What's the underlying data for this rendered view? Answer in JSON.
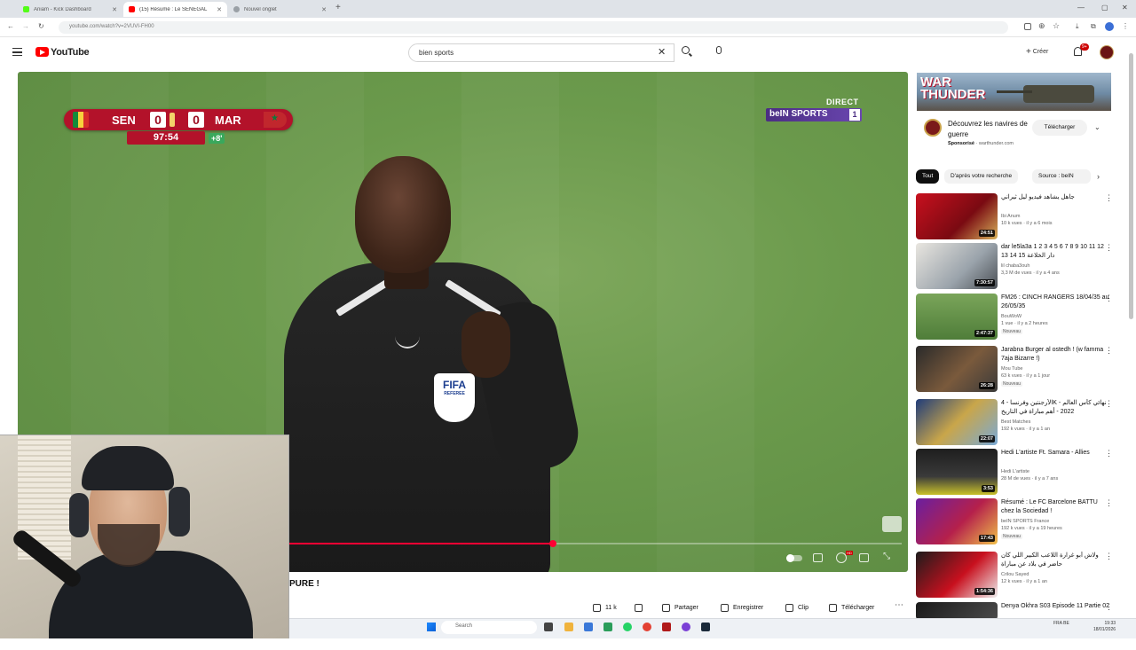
{
  "browser": {
    "tabs": [
      {
        "label": "Aniam - Kick Dashboard",
        "active": false,
        "fav_color": "#53fc18"
      },
      {
        "label": "(15) Résumé : Le SENEGAL",
        "active": true,
        "fav_color": "#ff0000"
      },
      {
        "label": "Nouvel onglet",
        "active": false,
        "fav_color": "#9aa0a6"
      }
    ],
    "url": "youtube.com/watch?v=2VUVI-FH00"
  },
  "header": {
    "logo_text": "YouTube",
    "search_value": "bien sports",
    "create_label": "Créer",
    "notif_count": "9+"
  },
  "video": {
    "scorebug": {
      "home": "SEN",
      "away": "MAR",
      "home_score": "0",
      "away_score": "0",
      "clock": "97:54",
      "added_time": "+8'"
    },
    "live_label": "DIRECT",
    "channel_bug": "beIN SPORTS",
    "channel_number": "1",
    "badge_text": "FIFA",
    "badge_sub": "REFEREE",
    "progress": 0.43,
    "title_fragment": "PURE !"
  },
  "actions": {
    "likes": "11 k",
    "share": "Partager",
    "save": "Enregistrer",
    "clip": "Clip",
    "download": "Télécharger"
  },
  "sidebar": {
    "ad": {
      "banner_title_1": "WAR",
      "banner_title_2": "THUNDER",
      "title": "Découvrez les navires de guerre",
      "sponsor_label": "Sponsorisé",
      "sponsor_site": "warthunder.com",
      "cta": "Télécharger"
    },
    "chips": [
      "Tout",
      "D'après votre recherche",
      "Source : beIN"
    ],
    "recommendations": [
      {
        "title": "جاهل يشاهد فيديو ليل ثيراني",
        "channel": "Ibi Anum",
        "meta": "10 k vues · il y a 6 mois",
        "badge": "",
        "duration": "24:51"
      },
      {
        "title": "dar le5la3a 1 2 3 4 5 6 7 8 9 10 11 12 13 14 15 دار الخلاعة",
        "channel": "lil chaba3ouh",
        "meta": "3,3 M de vues · il y a 4 ans",
        "badge": "",
        "duration": "7:30:57"
      },
      {
        "title": "FM26 : CINCH RANGERS 18/04/35 au 26/05/35",
        "channel": "BouWoW",
        "meta": "1 vue · il y a 2 heures",
        "badge": "Nouveau",
        "duration": "2:47:37"
      },
      {
        "title": "Jarabna Burger al ostedh ! (w famma 7aja Bizarre !)",
        "channel": "Mou Tube",
        "meta": "63 k vues · il y a 1 jour",
        "badge": "Nouveau",
        "duration": "26:28"
      },
      {
        "title": "الأرجنتين وفرنسا - 4K - نهائي كأس العالم 2022 - أهم مباراة في التاريخ",
        "channel": "Best Matches",
        "meta": "192 k vues · il y a 1 an",
        "badge": "",
        "duration": "22:07"
      },
      {
        "title": "Hedi L'artiste Ft. Samara - Allies",
        "channel": "Hedi L'artiste",
        "meta": "28 M de vues · il y a 7 ans",
        "badge": "",
        "duration": "3:53"
      },
      {
        "title": "Résumé : Le FC Barcelone BATTU chez la Sociedad !",
        "channel": "beIN SPORTS France",
        "meta": "192 k vues · il y a 19 heures",
        "badge": "Nouveau",
        "duration": "17:43"
      },
      {
        "title": "ولاش أبو غرارة اللاعب الكبير اللي كان حاضر في بلاد عن مباراة",
        "channel": "Crilou Sayed",
        "meta": "12 k vues · il y a 1 an",
        "badge": "",
        "duration": "1:54:36"
      },
      {
        "title": "Denya Okhra S03 Episode 11 Partie 02",
        "channel": "",
        "meta": "",
        "badge": "",
        "duration": ""
      }
    ]
  },
  "taskbar": {
    "search_placeholder": "Search",
    "lang": "FRA BE",
    "time": "19:33",
    "date": "18/01/2026"
  }
}
